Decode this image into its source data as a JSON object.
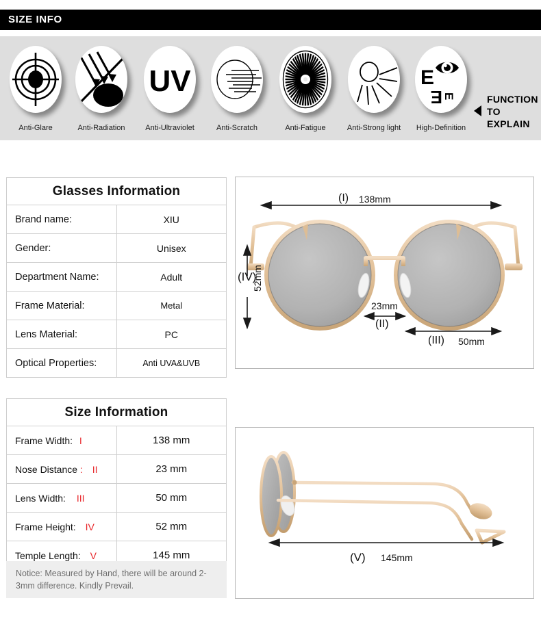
{
  "header": {
    "title": "SIZE INFO"
  },
  "features": {
    "explain_lines": [
      "FUNCTION",
      "TO",
      "EXPLAIN"
    ],
    "arrow_icon": "left-triangle-icon",
    "items": [
      {
        "label": "Anti-Glare",
        "icon": "crosshair-target-icon"
      },
      {
        "label": "Anti-Radiation",
        "icon": "blocked-radiation-rays-icon"
      },
      {
        "label": "Anti-Ultraviolet",
        "icon": "uv-text-icon"
      },
      {
        "label": "Anti-Scratch",
        "icon": "scratch-lines-lens-icon"
      },
      {
        "label": "Anti-Fatigue",
        "icon": "radial-sunburst-icon"
      },
      {
        "label": "Anti-Strong light",
        "icon": "sun-with-rays-icon"
      },
      {
        "label": "High-Definition",
        "icon": "eye-chart-vision-icon"
      }
    ]
  },
  "glasses_info": {
    "title": "Glasses Information",
    "rows": [
      {
        "key": "Brand name:",
        "value": "XIU"
      },
      {
        "key": "Gender:",
        "value": "Unisex"
      },
      {
        "key": "Department Name:",
        "value": "Adult"
      },
      {
        "key": "Frame Material:",
        "value": "Metal"
      },
      {
        "key": "Lens Material:",
        "value": "PC"
      },
      {
        "key": "Optical Properties:",
        "value": "Anti UVA&UVB"
      }
    ]
  },
  "size_info": {
    "title": "Size Information",
    "rows": [
      {
        "key": "Frame Width:",
        "numeral": "I",
        "value": "138 mm"
      },
      {
        "key": "Nose Distance",
        "numeral": "II",
        "value": "23 mm",
        "colon_red": true
      },
      {
        "key": "Lens Width:",
        "numeral": "III",
        "value": "50 mm"
      },
      {
        "key": "Frame Height:",
        "numeral": "IV",
        "value": "52 mm"
      },
      {
        "key": "Temple Length:",
        "numeral": "V",
        "value": "145 mm"
      }
    ]
  },
  "notice": {
    "text": "Notice:   Measured by Hand, there will be around 2-3mm difference. Kindly Prevail."
  },
  "front_diagram": {
    "frame_width_numeral": "(I)",
    "frame_width_value": "138mm",
    "frame_height_numeral": "(IV)",
    "frame_height_value": "52mm",
    "nose_distance_value": "23mm",
    "nose_distance_numeral": "(II)",
    "lens_width_numeral": "(III)",
    "lens_width_value": "50mm"
  },
  "side_diagram": {
    "temple_length_numeral": "(V)",
    "temple_length_value": "145mm"
  },
  "colors": {
    "header_bg": "#000000",
    "header_text": "#ffffff",
    "feature_bg": "#dedede",
    "accent_red": "#e8262a",
    "notice_bg": "#eeeeee",
    "notice_text": "#6e6e6e",
    "table_border": "#cfcfcf",
    "panel_border": "#b6b6b6",
    "frame_gold": "#e3c29a",
    "lens_gray": "#b2b2b2"
  }
}
